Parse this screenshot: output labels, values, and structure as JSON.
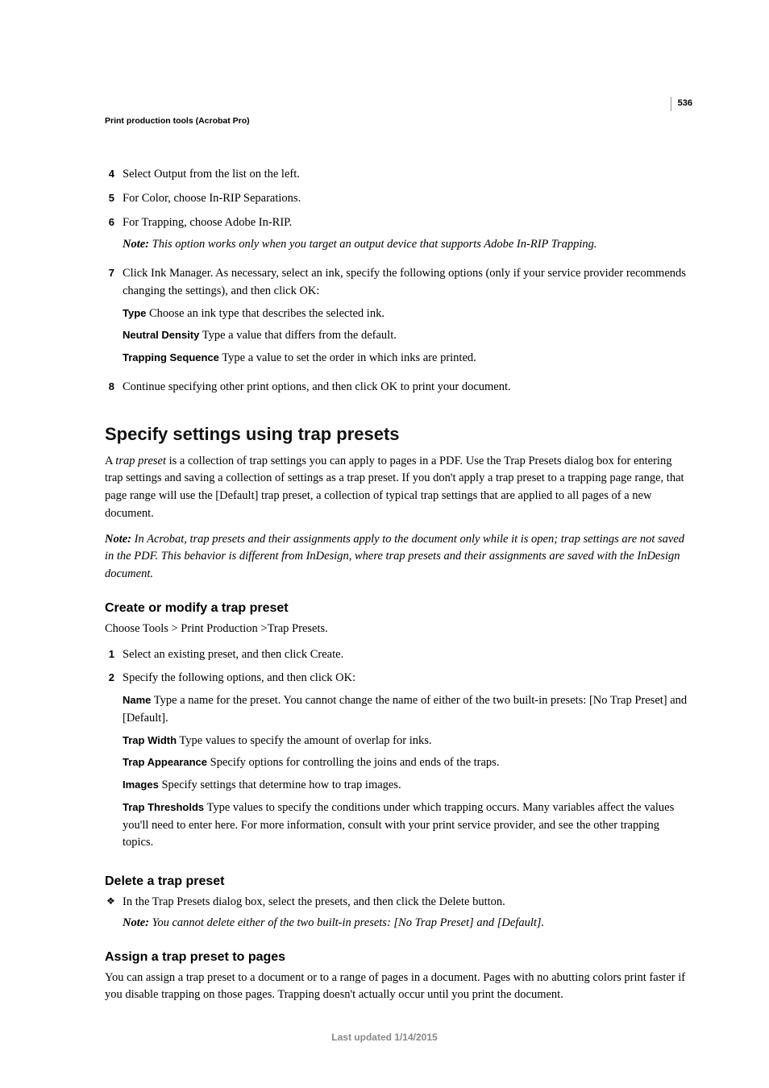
{
  "page_number": "536",
  "header": "Print production tools (Acrobat Pro)",
  "steps_a": {
    "s4": {
      "num": "4",
      "text": "Select Output from the list on the left."
    },
    "s5": {
      "num": "5",
      "text": "For Color, choose In-RIP Separations."
    },
    "s6": {
      "num": "6",
      "text": "For Trapping, choose Adobe In-RIP.",
      "note_label": "Note:",
      "note_text": "This option works only when you target an output device that supports Adobe In-RIP Trapping."
    },
    "s7": {
      "num": "7",
      "text": "Click Ink Manager. As necessary, select an ink, specify the following options (only if your service provider recommends changing the settings), and then click OK:",
      "opt_type_label": "Type",
      "opt_type_text": "Choose an ink type that describes the selected ink.",
      "opt_nd_label": "Neutral Density",
      "opt_nd_text": "Type a value that differs from the default.",
      "opt_ts_label": "Trapping Sequence",
      "opt_ts_text": "Type a value to set the order in which inks are printed."
    },
    "s8": {
      "num": "8",
      "text": "Continue specifying other print options, and then click OK to print your document."
    }
  },
  "section_specify": {
    "heading": "Specify settings using trap presets",
    "p1_pre": "A ",
    "p1_term": "trap preset",
    "p1_post": " is a collection of trap settings you can apply to pages in a PDF. Use the Trap Presets dialog box for entering trap settings and saving a collection of settings as a trap preset. If you don't apply a trap preset to a trapping page range, that page range will use the [Default] trap preset, a collection of typical trap settings that are applied to all pages of a new document.",
    "note_label": "Note:",
    "note_text": "In Acrobat, trap presets and their assignments apply to the document only while it is open; trap settings are not saved in the PDF. This behavior is different from InDesign, where trap presets and their assignments are saved with the InDesign document."
  },
  "section_create": {
    "heading": "Create or modify a trap preset",
    "intro": "Choose Tools > Print Production >Trap Presets.",
    "s1": {
      "num": "1",
      "text": "Select an existing preset, and then click Create."
    },
    "s2": {
      "num": "2",
      "text": "Specify the following options, and then click OK:",
      "opt_name_label": "Name",
      "opt_name_text": "Type a name for the preset. You cannot change the name of either of the two built-in presets: [No Trap Preset] and [Default].",
      "opt_tw_label": "Trap Width",
      "opt_tw_text": "Type values to specify the amount of overlap for inks.",
      "opt_ta_label": "Trap Appearance",
      "opt_ta_text": "Specify options for controlling the joins and ends of the traps.",
      "opt_im_label": "Images",
      "opt_im_text": "Specify settings that determine how to trap images.",
      "opt_tt_label": "Trap Thresholds",
      "opt_tt_text": "Type values to specify the conditions under which trapping occurs. Many variables affect the values you'll need to enter here. For more information, consult with your print service provider, and see the other trapping topics."
    }
  },
  "section_delete": {
    "heading": "Delete a trap preset",
    "bullet_text": "In the Trap Presets dialog box, select the presets, and then click the Delete button.",
    "note_label": "Note:",
    "note_text": "You cannot delete either of the two built-in presets: [No Trap Preset] and [Default]."
  },
  "section_assign": {
    "heading": "Assign a trap preset to pages",
    "p1": "You can assign a trap preset to a document or to a range of pages in a document. Pages with no abutting colors print faster if you disable trapping on those pages. Trapping doesn't actually occur until you print the document."
  },
  "footer": "Last updated 1/14/2015"
}
